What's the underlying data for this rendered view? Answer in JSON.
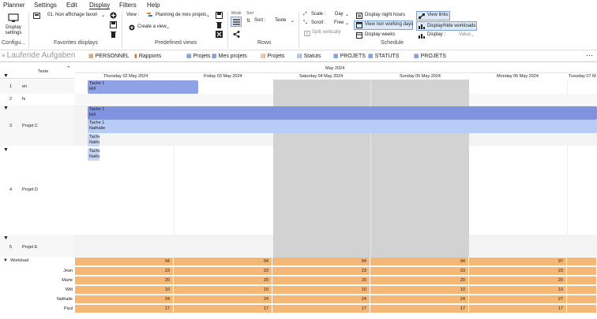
{
  "menu": [
    "Planner",
    "Settings",
    "Edit",
    "Display",
    "Filters",
    "Help"
  ],
  "ribbon": {
    "display_settings": "Display settings",
    "config_label": "Configu...",
    "favorite_value": "01. Non affichage favori",
    "favorites_label": "Favorites displays",
    "view_label": "View :",
    "view_value": "Planning de mes projets",
    "create_view": "Create a view",
    "predefined_label": "Predefined views",
    "mode_label": "Mode",
    "sort_title": "Sort",
    "sort_label": "Sort :",
    "sort_value": "Texte",
    "rows_label": "Rows",
    "scale_label": "Scale :",
    "scale_value": "Day",
    "scroll_label": "Scroll :",
    "scroll_value": "Free",
    "split_label": "Split vertically",
    "night_label": "Display night hours",
    "nonworking_label": "View non working days",
    "weeks_label": "Display weeks",
    "schedule_label": "Schedule",
    "links_label": "View links",
    "workloads_label": "Display/hide workloads",
    "display_label": "Display :",
    "display_value": "Value"
  },
  "tabs": [
    "Laufende Aufgaben",
    "PERSONNEL",
    "Rapports",
    "Projets",
    "Mes projets",
    "Projets",
    "Statuts",
    "PROJETS",
    "STATUTS",
    "PROJETS"
  ],
  "grid": {
    "text_header": "Texte",
    "month": "May 2024",
    "days": [
      "Thursday 02 May 2024",
      "Friday 03 May 2024",
      "Saturday 04 May 2024",
      "Sunday 05 May 2024",
      "Monday 06 May 2024",
      "Tuesday 07 M"
    ],
    "rows": [
      {
        "num": "1",
        "name": "en"
      },
      {
        "num": "2",
        "name": "fs"
      },
      {
        "num": "3",
        "name": "Projet C"
      },
      {
        "num": "4",
        "name": "Projet D"
      },
      {
        "num": "5",
        "name": "Projet E"
      }
    ],
    "tasks": [
      {
        "line1": "Tache 1",
        "line2": "kkll"
      },
      {
        "line1": "Tache 1",
        "line2": "kkll"
      },
      {
        "line1": "Tache 1",
        "line2": "Nathalie"
      },
      {
        "line1": "Tache",
        "line2": "Natha"
      },
      {
        "line1": "Tache",
        "line2": "Natha"
      }
    ]
  },
  "workload": {
    "label": "Workload",
    "rows": [
      {
        "name": "",
        "values": [
          "94",
          "94",
          "94",
          "94",
          "97",
          ""
        ]
      },
      {
        "name": "Jean",
        "values": [
          "23",
          "23",
          "23",
          "23",
          "23",
          ""
        ]
      },
      {
        "name": "Marie",
        "values": [
          "20",
          "20",
          "20",
          "20",
          "20",
          ""
        ]
      },
      {
        "name": "Wilt",
        "values": [
          "10",
          "10",
          "10",
          "10",
          "10",
          ""
        ]
      },
      {
        "name": "Nathalie",
        "values": [
          "24",
          "24",
          "24",
          "24",
          "27",
          ""
        ]
      },
      {
        "name": "Paul",
        "values": [
          "17",
          "17",
          "17",
          "17",
          "17",
          ""
        ]
      }
    ]
  }
}
